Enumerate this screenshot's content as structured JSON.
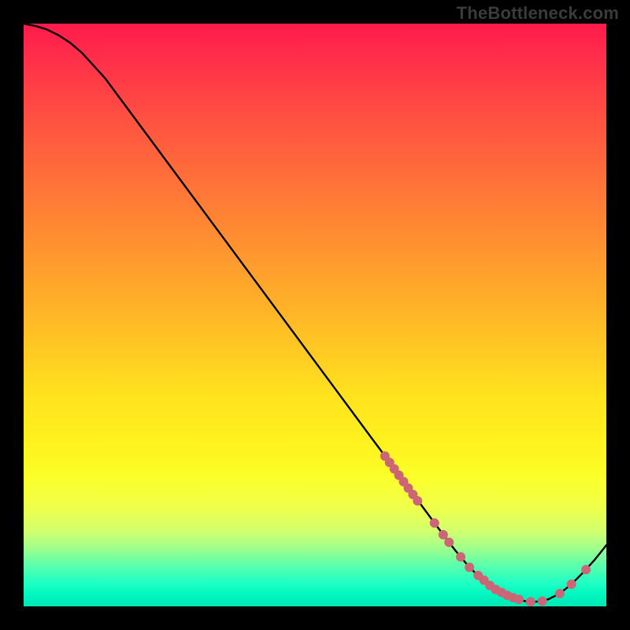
{
  "watermark": "TheBottleneck.com",
  "chart_data": {
    "type": "line",
    "title": "",
    "xlabel": "",
    "ylabel": "",
    "xlim": [
      0,
      100
    ],
    "ylim": [
      0,
      100
    ],
    "grid": false,
    "legend": false,
    "series": [
      {
        "name": "curve",
        "color": "#000000",
        "x": [
          0,
          2,
          4,
          6,
          8,
          10,
          14,
          20,
          30,
          40,
          50,
          60,
          65,
          68,
          70,
          72,
          74,
          76,
          78,
          80,
          82,
          84,
          86,
          88,
          90,
          92,
          94,
          96,
          98,
          100
        ],
        "y": [
          100,
          99.6,
          99.0,
          98.0,
          96.7,
          95.0,
          90.6,
          82.5,
          69.0,
          55.5,
          42.0,
          28.5,
          21.8,
          17.7,
          15.0,
          12.3,
          9.7,
          7.3,
          5.2,
          3.6,
          2.3,
          1.4,
          0.9,
          0.8,
          1.2,
          2.2,
          3.8,
          5.8,
          8.0,
          10.5
        ]
      }
    ],
    "markers": [
      {
        "name": "dots",
        "color": "#cc6677",
        "radius_px": 6,
        "points": [
          {
            "x": 62.0,
            "y": 25.8
          },
          {
            "x": 62.8,
            "y": 24.7
          },
          {
            "x": 63.6,
            "y": 23.6
          },
          {
            "x": 64.4,
            "y": 22.5
          },
          {
            "x": 65.2,
            "y": 21.4
          },
          {
            "x": 66.0,
            "y": 20.3
          },
          {
            "x": 66.8,
            "y": 19.2
          },
          {
            "x": 67.6,
            "y": 18.1
          },
          {
            "x": 70.5,
            "y": 14.3
          },
          {
            "x": 72.0,
            "y": 12.3
          },
          {
            "x": 73.0,
            "y": 11.0
          },
          {
            "x": 75.0,
            "y": 8.5
          },
          {
            "x": 76.5,
            "y": 6.7
          },
          {
            "x": 78.0,
            "y": 5.3
          },
          {
            "x": 79.0,
            "y": 4.5
          },
          {
            "x": 80.0,
            "y": 3.6
          },
          {
            "x": 81.0,
            "y": 2.9
          },
          {
            "x": 82.0,
            "y": 2.4
          },
          {
            "x": 83.0,
            "y": 1.9
          },
          {
            "x": 84.0,
            "y": 1.5
          },
          {
            "x": 85.0,
            "y": 1.2
          },
          {
            "x": 87.0,
            "y": 0.8
          },
          {
            "x": 89.0,
            "y": 0.9
          },
          {
            "x": 92.0,
            "y": 2.2
          },
          {
            "x": 94.0,
            "y": 3.8
          },
          {
            "x": 96.5,
            "y": 6.3
          }
        ]
      }
    ],
    "background_gradient": {
      "direction": "vertical",
      "stops": [
        {
          "pos": 0.0,
          "color": "#ff1a4b"
        },
        {
          "pos": 0.5,
          "color": "#ffd423"
        },
        {
          "pos": 0.82,
          "color": "#f4ff3c"
        },
        {
          "pos": 1.0,
          "color": "#00e8b4"
        }
      ]
    }
  }
}
